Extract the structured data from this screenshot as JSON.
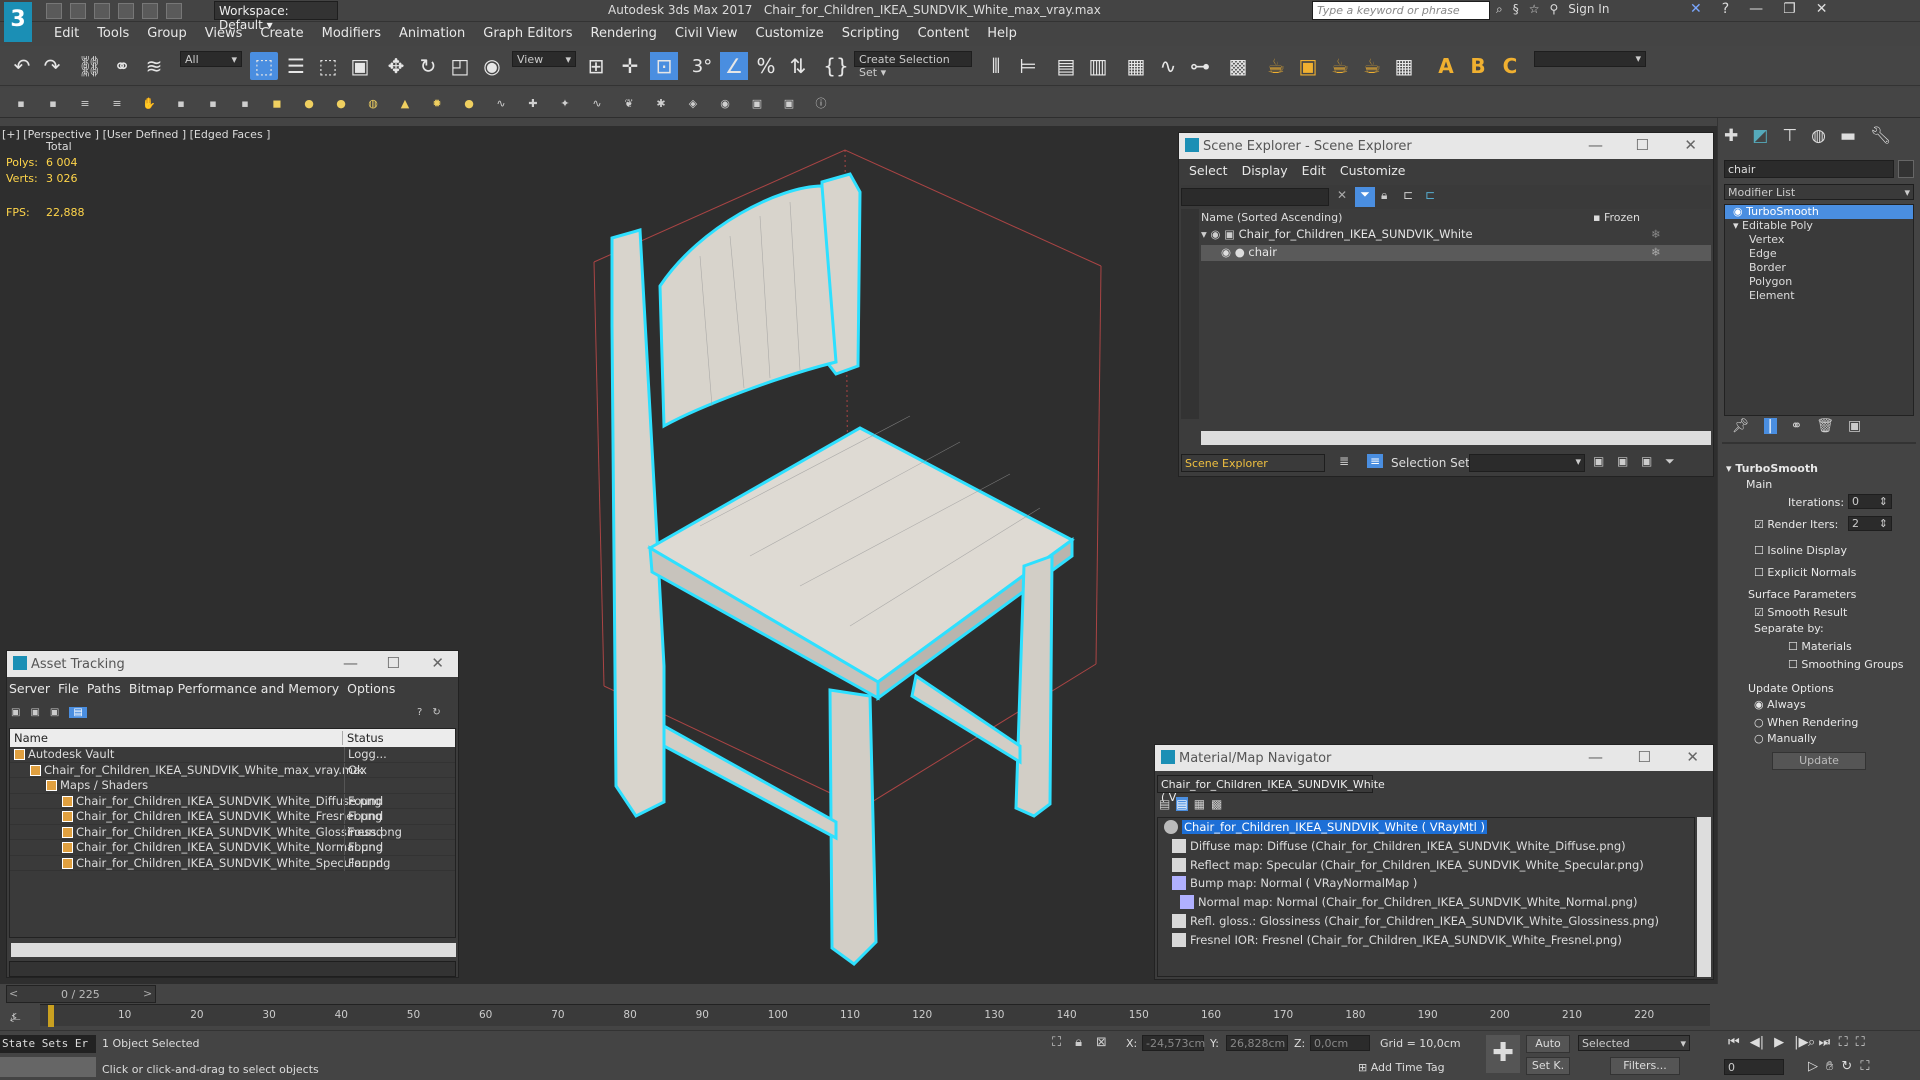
{
  "app": {
    "title": "Autodesk 3ds Max 2017",
    "file": "Chair_for_Children_IKEA_SUNDVIK_White_max_vray.max",
    "workspace": "Workspace: Default",
    "search_placeholder": "Type a keyword or phrase",
    "sign_in": "Sign In"
  },
  "menu": [
    "Edit",
    "Tools",
    "Group",
    "Views",
    "Create",
    "Modifiers",
    "Animation",
    "Graph Editors",
    "Rendering",
    "Civil View",
    "Customize",
    "Scripting",
    "Content",
    "Help"
  ],
  "toolbar": {
    "filter": "All",
    "view_dropdown": "View",
    "selection_set": "Create Selection Set",
    "icons": [
      "undo-icon",
      "redo-icon",
      "link-icon",
      "unlink-icon",
      "bind-spacewarp-icon",
      "select-icon",
      "select-by-name-icon",
      "rect-region-icon",
      "window-crossing-icon",
      "move-icon",
      "rotate-icon",
      "scale-icon",
      "placement-icon",
      "pivot-icon",
      "snap-icon",
      "angle-snap-icon",
      "percent-snap-icon",
      "spinner-snap-icon",
      "named-sets-icon",
      "mirror-icon",
      "align-icon",
      "layer-explorer-icon",
      "scene-explorer-icon",
      "ribbon-icon",
      "curve-editor-icon",
      "schematic-icon",
      "material-editor-icon",
      "render-setup-icon",
      "render-frame-icon",
      "render-icon",
      "render-iterative-icon",
      "render-online-icon",
      "text-a-icon",
      "text-b-icon",
      "text-c-icon"
    ]
  },
  "viewport": {
    "label": "[+] [Perspective ] [User Defined ] [Edged Faces ]",
    "stats_header": "Total",
    "polys_label": "Polys:",
    "polys": "6 004",
    "verts_label": "Verts:",
    "verts": "3 026",
    "fps_label": "FPS:",
    "fps": "22,888"
  },
  "scene_explorer": {
    "title": "Scene Explorer - Scene Explorer",
    "menu": [
      "Select",
      "Display",
      "Edit",
      "Customize"
    ],
    "col_name": "Name (Sorted Ascending)",
    "col_frozen": "▪ Frozen",
    "rows": [
      {
        "name": "Chair_for_Children_IKEA_SUNDVIK_White"
      },
      {
        "name": "chair"
      }
    ],
    "footer_label": "Scene Explorer",
    "selection_set_label": "Selection Set:"
  },
  "asset_tracking": {
    "title": "Asset Tracking",
    "menu": [
      "Server",
      "File",
      "Paths",
      "Bitmap Performance and Memory",
      "Options"
    ],
    "col_name": "Name",
    "col_status": "Status",
    "rows": [
      {
        "name": "Autodesk Vault",
        "status": "Logg..."
      },
      {
        "name": "Chair_for_Children_IKEA_SUNDVIK_White_max_vray.max",
        "status": "Ok"
      },
      {
        "name": "Maps / Shaders",
        "status": ""
      },
      {
        "name": "Chair_for_Children_IKEA_SUNDVIK_White_Diffuse.png",
        "status": "Found"
      },
      {
        "name": "Chair_for_Children_IKEA_SUNDVIK_White_Fresnel.png",
        "status": "Found"
      },
      {
        "name": "Chair_for_Children_IKEA_SUNDVIK_White_Glossiness.png",
        "status": "Found"
      },
      {
        "name": "Chair_for_Children_IKEA_SUNDVIK_White_Normal.png",
        "status": "Found"
      },
      {
        "name": "Chair_for_Children_IKEA_SUNDVIK_White_Specular.png",
        "status": "Found"
      }
    ]
  },
  "material_navigator": {
    "title": "Material/Map Navigator",
    "field": "Chair_for_Children_IKEA_SUNDVIK_White  ( V",
    "rows": [
      "Chair_for_Children_IKEA_SUNDVIK_White  ( VRayMtl )",
      "Diffuse map: Diffuse (Chair_for_Children_IKEA_SUNDVIK_White_Diffuse.png)",
      "Reflect map: Specular (Chair_for_Children_IKEA_SUNDVIK_White_Specular.png)",
      "Bump map: Normal  ( VRayNormalMap )",
      "Normal map: Normal (Chair_for_Children_IKEA_SUNDVIK_White_Normal.png)",
      "Refl. gloss.: Glossiness (Chair_for_Children_IKEA_SUNDVIK_White_Glossiness.png)",
      "Fresnel IOR: Fresnel (Chair_for_Children_IKEA_SUNDVIK_White_Fresnel.png)"
    ]
  },
  "command_panel": {
    "object_name": "chair",
    "modifier_list": "Modifier List",
    "stack": [
      "TurboSmooth",
      "Editable Poly",
      "Vertex",
      "Edge",
      "Border",
      "Polygon",
      "Element"
    ],
    "rollout_title": "TurboSmooth",
    "main_label": "Main",
    "iterations_label": "Iterations:",
    "iterations": "0",
    "render_iters_label": "Render Iters:",
    "render_iters": "2",
    "isoline": "Isoline Display",
    "explicit_normals": "Explicit Normals",
    "surface_params": "Surface Parameters",
    "smooth_result": "Smooth Result",
    "separate_by": "Separate by:",
    "materials": "Materials",
    "smoothing_groups": "Smoothing Groups",
    "update_options": "Update Options",
    "always": "Always",
    "when_rendering": "When Rendering",
    "manually": "Manually",
    "update_button": "Update"
  },
  "timeline": {
    "frame": "0 / 225",
    "ticks": [
      "10",
      "20",
      "30",
      "40",
      "50",
      "60",
      "70",
      "80",
      "90",
      "100",
      "110",
      "120",
      "130",
      "140",
      "150",
      "160",
      "170",
      "180",
      "190",
      "200",
      "210",
      "220"
    ]
  },
  "status": {
    "state_sets": "State Sets Er",
    "selected": "1 Object Selected",
    "prompt": "Click or click-and-drag to select objects",
    "x_label": "X:",
    "x": "-24,573cm",
    "y_label": "Y:",
    "y": "26,828cm",
    "z_label": "Z:",
    "z": "0,0cm",
    "grid": "Grid = 10,0cm",
    "add_time_tag": "Add Time Tag",
    "auto": "Auto",
    "setk": "Set K.",
    "selected_dd": "Selected",
    "filters": "Filters...",
    "frame_field": "0"
  },
  "colors": {
    "selection": "#2ee0ff",
    "highlight": "#4a8ee0",
    "stats": "#ffd54a"
  }
}
